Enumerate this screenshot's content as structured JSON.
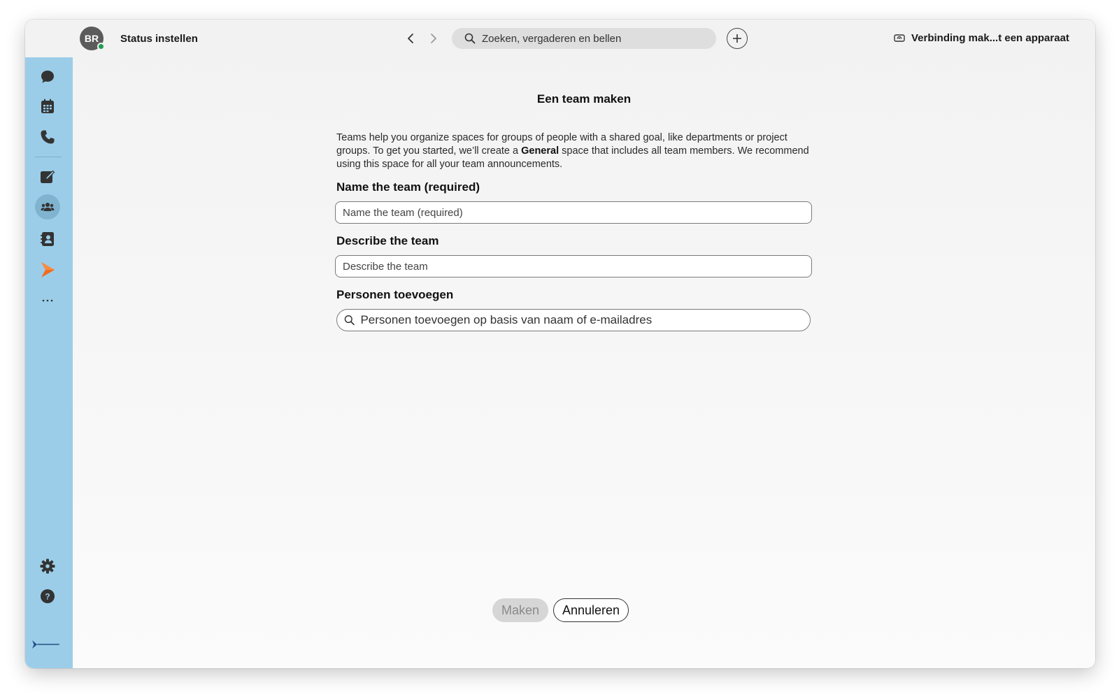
{
  "header": {
    "avatar_initials": "BR",
    "status_label": "Status instellen",
    "search_placeholder": "Zoeken, vergaderen en bellen",
    "connect_label": "Verbinding mak...t een apparaat"
  },
  "sidebar": {
    "items": [
      {
        "name": "messaging",
        "icon": "chat-bubble-icon"
      },
      {
        "name": "meetings",
        "icon": "calendar-icon"
      },
      {
        "name": "calling",
        "icon": "phone-icon"
      },
      {
        "name": "compose",
        "icon": "compose-icon"
      },
      {
        "name": "teams",
        "icon": "team-icon",
        "active": true
      },
      {
        "name": "contacts",
        "icon": "contacts-icon"
      },
      {
        "name": "webex-app",
        "icon": "arrow-app-icon"
      },
      {
        "name": "more",
        "icon": "more-icon"
      }
    ],
    "settings_icon": "gear-icon",
    "help_icon": "help-icon"
  },
  "form": {
    "title": "Een team maken",
    "description_pre": "Teams help you organize spaces for groups of people with a shared goal, like departments or project groups. To get you started, we’ll create a ",
    "description_bold": "General",
    "description_post": " space that includes all team members. We recommend using this space for all your team announcements.",
    "name_label": "Name the team (required)",
    "name_placeholder": "Name the team (required)",
    "describe_label": "Describe the team",
    "describe_placeholder": "Describe the team",
    "people_label": "Personen toevoegen",
    "people_placeholder": "Personen toevoegen op basis van naam of e-mailadres"
  },
  "actions": {
    "make_label": "Maken",
    "cancel_label": "Annuleren"
  },
  "colors": {
    "sidebar_bg": "#9bcde8",
    "presence": "#1f9d55",
    "accent_orange": "#f26b1d"
  }
}
